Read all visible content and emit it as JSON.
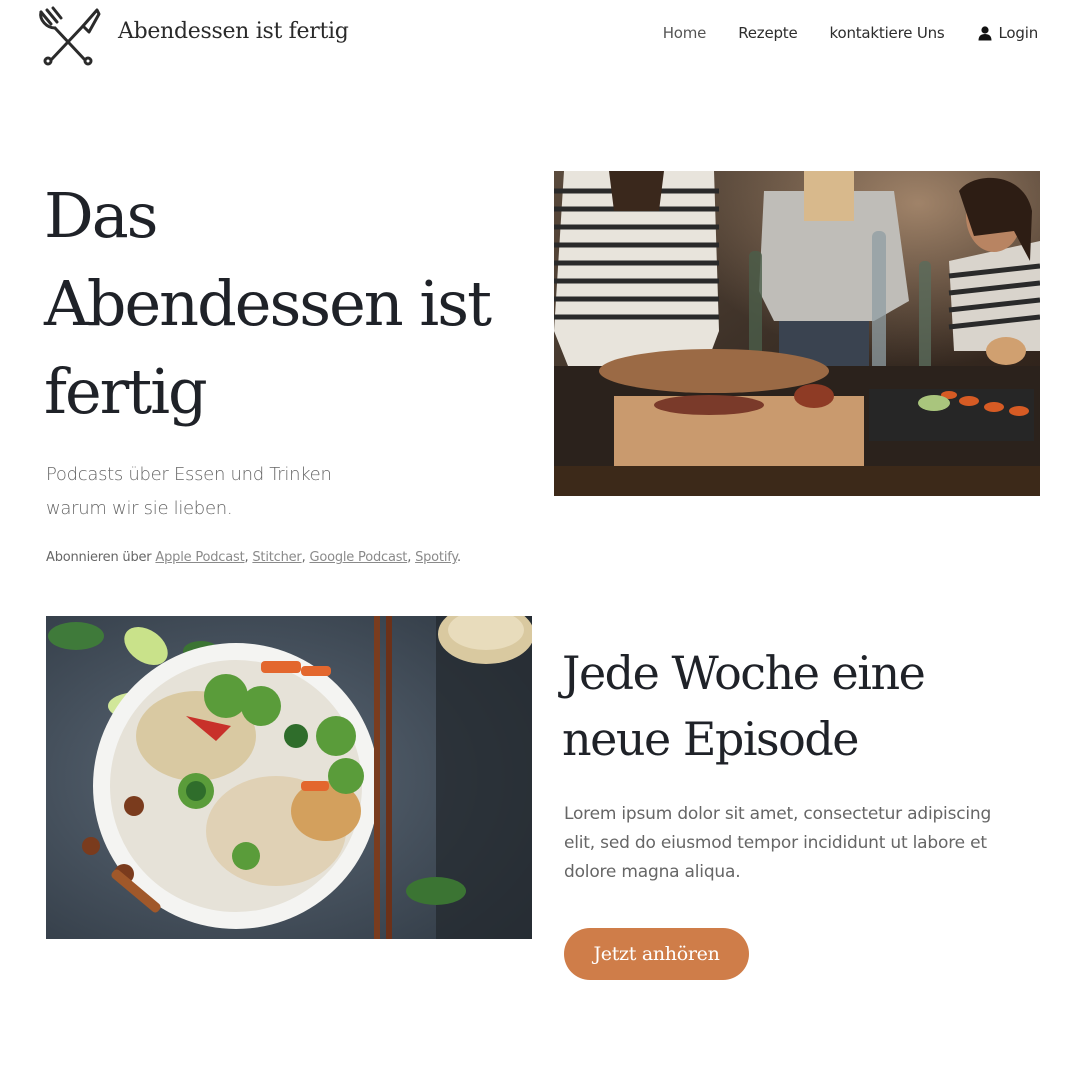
{
  "header": {
    "brand": "Abendessen ist fertig",
    "nav": [
      {
        "label": "Home"
      },
      {
        "label": "Rezepte"
      },
      {
        "label": "kontaktiere Uns"
      },
      {
        "label": "Login"
      }
    ]
  },
  "hero": {
    "title": "Das Abendessen ist fertig",
    "subtitle_line1": "Podcasts über Essen und Trinken",
    "subtitle_line2": "warum wir sie lieben.",
    "subscribe_prefix": "Abonnieren über",
    "platforms": [
      "Apple Podcast",
      "Stitcher",
      "Google Podcast",
      "Spotify"
    ]
  },
  "episode": {
    "title": "Jede Woche eine neue Episode",
    "text": "Lorem ipsum dolor sit amet, consectetur adipiscing elit, sed do eiusmod tempor incididunt ut labore et dolore magna aliqua.",
    "button_label": "Jetzt anhören"
  },
  "colors": {
    "accent": "#cf7d49",
    "heading": "#1f2228",
    "body_text": "#666666"
  },
  "icons": [
    "fork-knife-logo-icon",
    "user-icon"
  ]
}
